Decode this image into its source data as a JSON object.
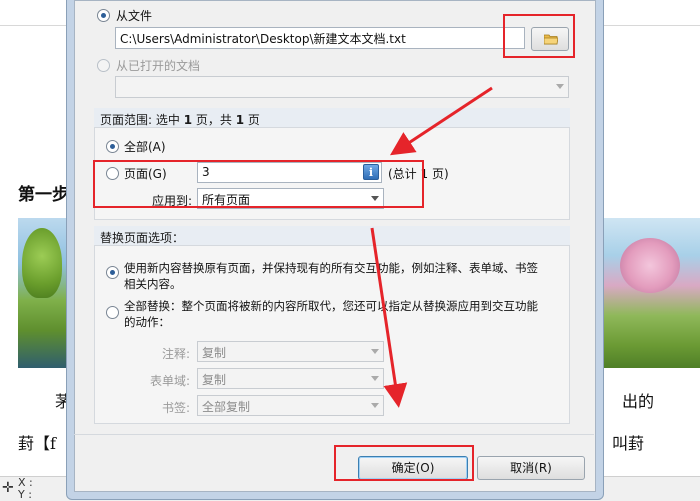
{
  "colors": {
    "annotation": "#e5242a",
    "accent": "#2d5e98",
    "group_header": "#e8edf3"
  },
  "background": {
    "heading_fragment": "第一步",
    "text_left_1": "茅",
    "text_left_2": "葑【f",
    "text_right_1": "出的",
    "text_right_2": "，叫葑",
    "status_x": "X :",
    "status_y": "Y :"
  },
  "source": {
    "from_file_label": "从文件",
    "file_path": "C:\\Users\\Administrator\\Desktop\\新建文本文档.txt",
    "browse_icon": "folder-icon",
    "from_open_doc_label": "从已打开的文档",
    "open_doc_value": ""
  },
  "page_range": {
    "header_prefix": "页面范围: 选中",
    "selected": "1",
    "header_mid": "页，共",
    "total": "1",
    "header_suffix": "页",
    "all_label": "全部(A)",
    "pages_label": "页面(G)",
    "pages_value": "3",
    "info_icon": "info-icon",
    "total_label": "(总计 1 页)",
    "apply_to_label": "应用到:",
    "apply_to_value": "所有页面"
  },
  "replace": {
    "header": "替换页面选项：",
    "option1_text_line1": "使用新内容替换原有页面，并保持现有的所有交互功能，例如注释、表单域、书签",
    "option1_text_line2": "相关内容。",
    "option2_text_line1": "全部替换：整个页面将被新的内容所取代，您还可以指定从替换源应用到交互功能",
    "option2_text_line2": "的动作：",
    "annotations_label": "注释:",
    "annotations_value": "复制",
    "form_fields_label": "表单域:",
    "form_fields_value": "复制",
    "bookmarks_label": "书签:",
    "bookmarks_value": "全部复制"
  },
  "buttons": {
    "ok": "确定(O)",
    "cancel": "取消(R)"
  }
}
